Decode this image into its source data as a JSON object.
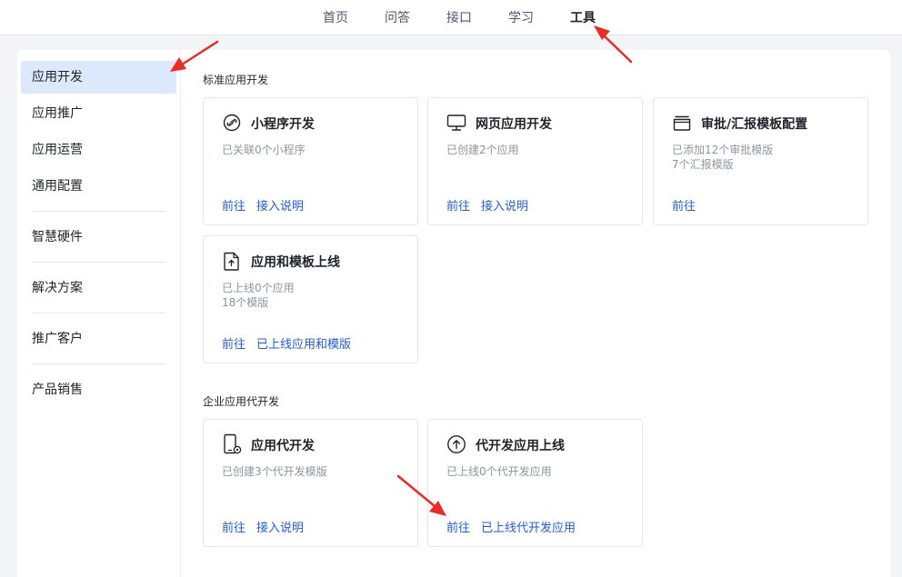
{
  "topnav": {
    "items": [
      {
        "label": "首页"
      },
      {
        "label": "问答"
      },
      {
        "label": "接口"
      },
      {
        "label": "学习"
      },
      {
        "label": "工具"
      }
    ]
  },
  "sidebar": {
    "items": [
      {
        "label": "应用开发"
      },
      {
        "label": "应用推广"
      },
      {
        "label": "应用运营"
      },
      {
        "label": "通用配置"
      },
      {
        "label": "智慧硬件"
      },
      {
        "label": "解决方案"
      },
      {
        "label": "推广客户"
      },
      {
        "label": "产品销售"
      }
    ]
  },
  "sections": [
    {
      "title": "标准应用开发",
      "cards": [
        {
          "icon": "link-icon",
          "title": "小程序开发",
          "desc": [
            "已关联0个小程序"
          ],
          "links": [
            "前往",
            "接入说明"
          ]
        },
        {
          "icon": "monitor-icon",
          "title": "网页应用开发",
          "desc": [
            "已创建2个应用"
          ],
          "links": [
            "前往",
            "接入说明"
          ]
        },
        {
          "icon": "template-icon",
          "title": "审批/汇报模板配置",
          "desc": [
            "已添加12个审批模版",
            "7个汇报模版"
          ],
          "links": [
            "前往"
          ]
        },
        {
          "icon": "file-upload-icon",
          "title": "应用和模板上线",
          "desc": [
            "已上线0个应用",
            "18个模版"
          ],
          "links": [
            "前往",
            "已上线应用和模版"
          ]
        }
      ]
    },
    {
      "title": "企业应用代开发",
      "cards": [
        {
          "icon": "phone-gear-icon",
          "title": "应用代开发",
          "desc": [
            "已创建3个代开发模版"
          ],
          "links": [
            "前往",
            "接入说明"
          ]
        },
        {
          "icon": "circle-upload-icon",
          "title": "代开发应用上线",
          "desc": [
            "已上线0个代开发应用"
          ],
          "links": [
            "前往",
            "已上线代开发应用"
          ]
        }
      ]
    }
  ],
  "colors": {
    "accent": "#245bdb",
    "active_bg": "#dce8fb",
    "annotation": "#ee2a24"
  }
}
